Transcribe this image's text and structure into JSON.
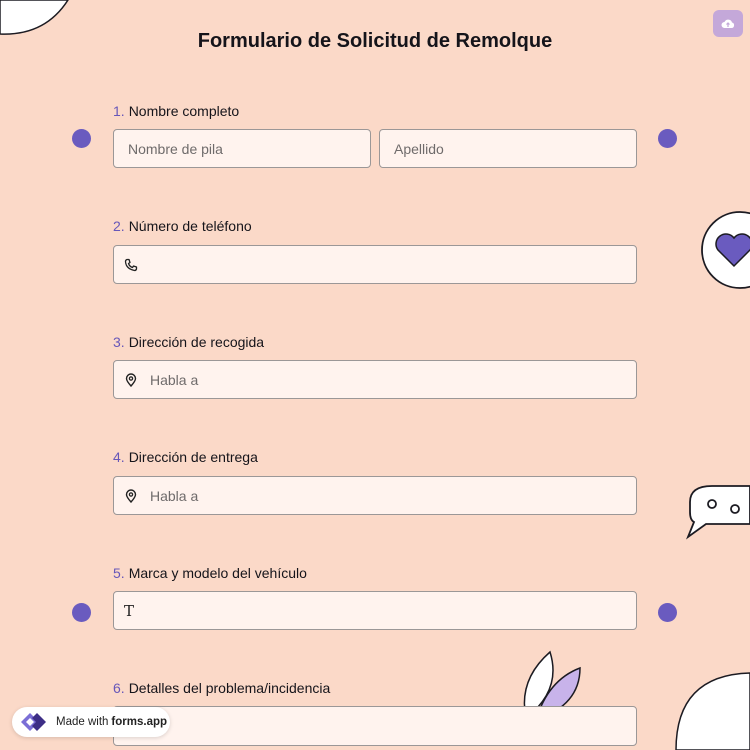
{
  "form": {
    "title": "Formulario de Solicitud de Remolque"
  },
  "toolbar": {
    "save_icon": "cloud-upload-icon"
  },
  "questions": [
    {
      "number": "1.",
      "label": "Nombre completo",
      "fields": [
        {
          "placeholder": "Nombre de pila"
        },
        {
          "placeholder": "Apellido"
        }
      ]
    },
    {
      "number": "2.",
      "label": "Número de teléfono",
      "icon": "phone-icon",
      "placeholder": ""
    },
    {
      "number": "3.",
      "label": "Dirección de recogida",
      "icon": "location-pin-icon",
      "placeholder": "Habla a"
    },
    {
      "number": "4.",
      "label": "Dirección de entrega",
      "icon": "location-pin-icon",
      "placeholder": "Habla a"
    },
    {
      "number": "5.",
      "label": "Marca y modelo del vehículo",
      "icon": "text-icon",
      "icon_glyph": "T",
      "placeholder": ""
    },
    {
      "number": "6.",
      "label": "Detalles del problema/incidencia",
      "placeholder": ""
    }
  ],
  "badge": {
    "prefix": "Made with",
    "brand": "forms.app"
  },
  "colors": {
    "background": "#fbd9c8",
    "accent": "#6a5bbf",
    "field_bg": "#fff3ee"
  }
}
